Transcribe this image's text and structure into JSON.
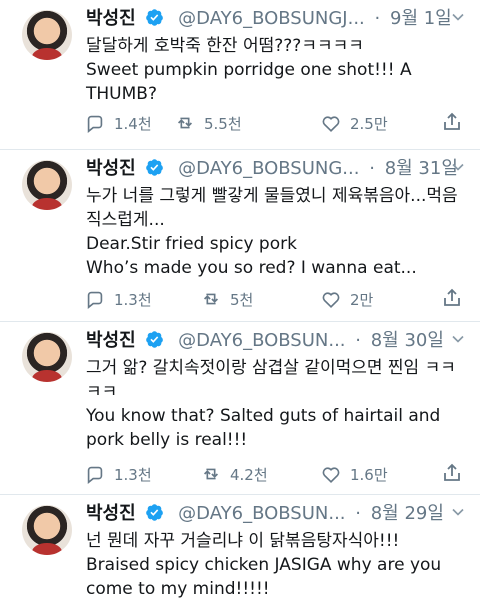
{
  "tweets": [
    {
      "name": "박성진",
      "handle": "@DAY6_BOBSUNGJ...",
      "date": "9월 1일",
      "lines": [
        "달달하게 호박죽 한잔 어떰???ㅋㅋㅋㅋ",
        "Sweet pumpkin porridge one shot!!! A THUMB?"
      ],
      "replies": "1.4천",
      "retweets": "5.5천",
      "likes": "2.5만"
    },
    {
      "name": "박성진",
      "handle": "@DAY6_BOBSUNG...",
      "date": "8월 31일",
      "lines": [
        "누가 너를 그렇게 빨갛게 물들였니 제육볶음아...먹음직스럽게...",
        "Dear.Stir fried spicy pork",
        "Who’s made you so red? I wanna eat..."
      ],
      "replies": "1.3천",
      "retweets": "5천",
      "likes": "2만"
    },
    {
      "name": "박성진",
      "handle": "@DAY6_BOBSUN...",
      "date": "8월 30일",
      "lines": [
        "그거 앎? 갈치속젓이랑 삼겹살 같이먹으면 찐임 ㅋㅋㅋㅋ",
        "You know that? Salted guts of hairtail and pork belly is real!!!"
      ],
      "replies": "1.3천",
      "retweets": "4.2천",
      "likes": "1.6만"
    },
    {
      "name": "박성진",
      "handle": "@DAY6_BOBSUN...",
      "date": "8월 29일",
      "lines": [
        "넌 뭔데 자꾸 거슬리냐 이 닭볶음탕자식아!!!",
        "Braised spicy chicken JASIGA why are you come to my mind!!!!!"
      ],
      "replies": "",
      "retweets": "",
      "likes": ""
    }
  ],
  "colors": {
    "verified": "#1da1f2",
    "text": "#14171a",
    "muted": "#657786",
    "divider": "#e1e8ed"
  },
  "icons": [
    "more-icon",
    "verified-badge-icon",
    "reply-icon",
    "retweet-icon",
    "like-icon",
    "share-icon"
  ]
}
